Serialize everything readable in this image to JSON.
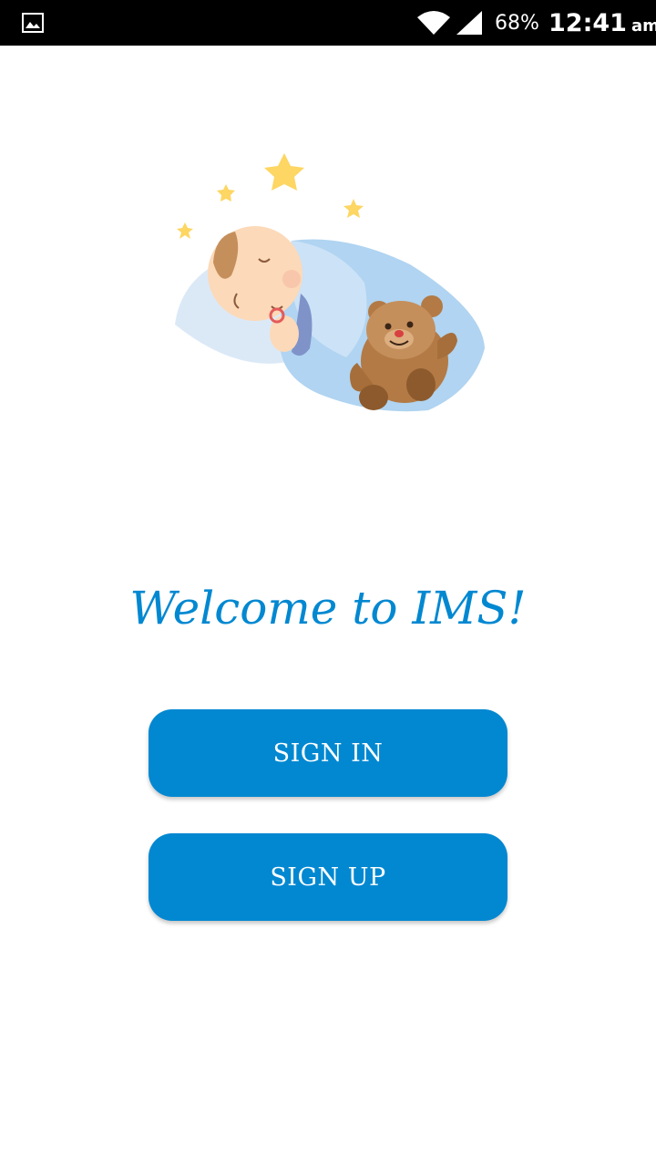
{
  "status_bar": {
    "battery": "68%",
    "time": "12:41",
    "ampm": "am",
    "icons": [
      "gallery-icon",
      "wifi-icon",
      "signal-icon"
    ]
  },
  "illustration": {
    "icon": "sleeping-baby-with-teddy-bear"
  },
  "welcome": {
    "title": "Welcome to IMS!"
  },
  "buttons": {
    "sign_in": "SIGN IN",
    "sign_up": "SIGN UP"
  },
  "colors": {
    "primary": "#0288d1",
    "status_bar": "#000000",
    "background": "#ffffff"
  }
}
